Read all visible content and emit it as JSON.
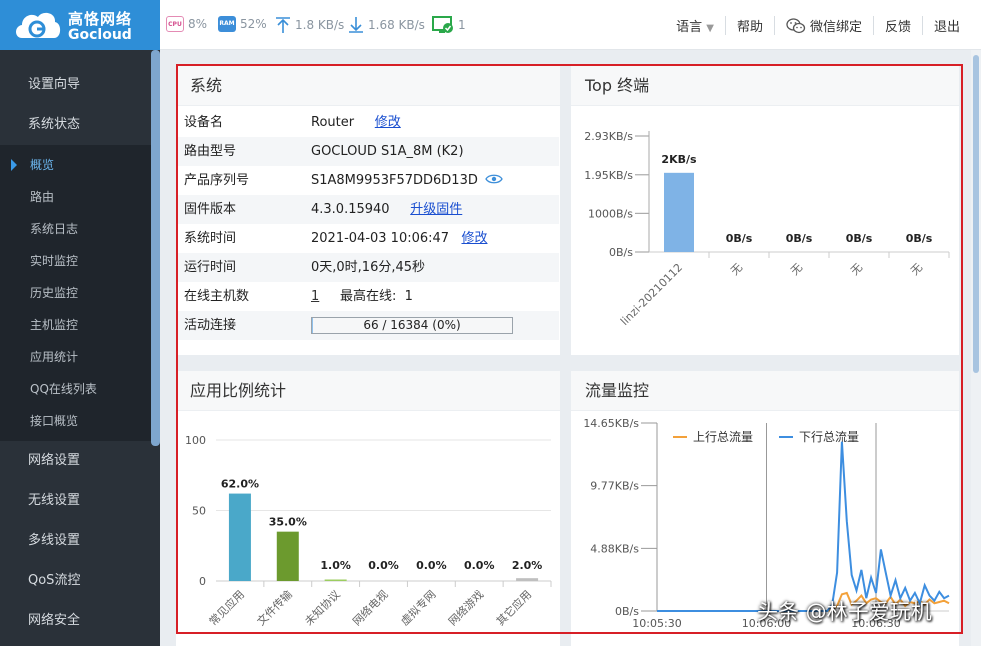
{
  "brand": {
    "name_cn": "高恪网络",
    "name_en": "Gocloud"
  },
  "header_stats": {
    "cpu_icon": "CPU",
    "cpu": "8%",
    "ram_icon": "RAM",
    "ram": "52%",
    "upload": "1.8 KB/s",
    "download": "1.68 KB/s",
    "devices": "1"
  },
  "top_menu": {
    "language": "语言",
    "help": "帮助",
    "wechat": "微信绑定",
    "feedback": "反馈",
    "logout": "退出"
  },
  "sidebar": {
    "groups_top": [
      {
        "label": "设置向导"
      },
      {
        "label": "系统状态"
      }
    ],
    "sub_items": [
      {
        "label": "概览"
      },
      {
        "label": "路由"
      },
      {
        "label": "系统日志"
      },
      {
        "label": "实时监控"
      },
      {
        "label": "历史监控"
      },
      {
        "label": "主机监控"
      },
      {
        "label": "应用统计"
      },
      {
        "label": "QQ在线列表"
      },
      {
        "label": "接口概览"
      }
    ],
    "groups_bottom": [
      {
        "label": "网络设置"
      },
      {
        "label": "无线设置"
      },
      {
        "label": "多线设置"
      },
      {
        "label": "QoS流控"
      },
      {
        "label": "网络安全"
      }
    ]
  },
  "system": {
    "title": "系统",
    "rows": [
      {
        "label": "设备名",
        "value": "Router",
        "link": "修改"
      },
      {
        "label": "路由型号",
        "value": "GOCLOUD S1A_8M (K2)"
      },
      {
        "label": "产品序列号",
        "value": "S1A8M9953F57DD6D13D"
      },
      {
        "label": "固件版本",
        "value": "4.3.0.15940",
        "link": "升级固件"
      },
      {
        "label": "系统时间",
        "value": "2021-04-03 10:06:47",
        "link": "修改"
      },
      {
        "label": "运行时间",
        "value": "0天,0时,16分,45秒"
      },
      {
        "label": "在线主机数",
        "value": "1",
        "extra_label": "最高在线:",
        "extra_value": "1"
      },
      {
        "label": "活动连接",
        "value": "66 / 16384 (0%)"
      }
    ],
    "active_connections_fraction": 0.004
  },
  "top_terminals": {
    "title": "Top 终端",
    "chart_data": {
      "type": "bar",
      "categories": [
        "linzi-20210112",
        "无",
        "无",
        "无",
        "无"
      ],
      "values": [
        2,
        0,
        0,
        0,
        0
      ],
      "value_labels": [
        "2KB/s",
        "0B/s",
        "0B/s",
        "0B/s",
        "0B/s"
      ],
      "yticks": [
        "2.93KB/s",
        "1.95KB/s",
        "1000B/s",
        "0B/s"
      ],
      "ylim": [
        0,
        2.93
      ],
      "unit": "KB/s",
      "color": "#7fb3e6"
    }
  },
  "app_ratio": {
    "title": "应用比例统计",
    "chart_data": {
      "type": "bar",
      "categories": [
        "常见应用",
        "文件传输",
        "未知协议",
        "网络电视",
        "虚拟专网",
        "网络游戏",
        "其它应用"
      ],
      "values": [
        62.0,
        35.0,
        1.0,
        0.0,
        0.0,
        0.0,
        2.0
      ],
      "value_labels": [
        "62.0%",
        "35.0%",
        "1.0%",
        "0.0%",
        "0.0%",
        "0.0%",
        "2.0%"
      ],
      "yticks": [
        "100",
        "50",
        "0"
      ],
      "ylim": [
        0,
        100
      ],
      "colors": [
        "#4aa8c9",
        "#6c9a2e",
        "#9ccd60",
        "#bfbfbf",
        "#bfbfbf",
        "#bfbfbf",
        "#bfbfbf"
      ]
    }
  },
  "traffic": {
    "title": "流量监控",
    "chart_data": {
      "type": "line",
      "yticks": [
        "14.65KB/s",
        "9.77KB/s",
        "4.88KB/s",
        "0B/s"
      ],
      "ylim": [
        0,
        14.65
      ],
      "xticks": [
        "10:05:30",
        "10:06:00",
        "10:06:30"
      ],
      "legend_position": "top-left",
      "series": [
        {
          "name": "上行总流量",
          "color": "#f3a13a",
          "x": [
            0,
            5,
            10,
            15,
            20,
            25,
            28,
            30,
            32,
            34,
            36,
            38,
            40,
            42,
            44,
            46,
            48,
            50,
            52,
            54,
            56,
            58,
            60,
            62,
            64,
            66,
            68,
            70,
            72,
            74,
            76,
            78,
            80,
            82,
            84,
            86,
            88,
            90,
            92,
            94,
            96,
            98,
            100,
            102,
            104,
            106,
            108,
            110,
            112,
            114,
            116,
            118,
            120
          ],
          "y": [
            0,
            0,
            0,
            0,
            0,
            0,
            0,
            0,
            0,
            0,
            0,
            0,
            0,
            0,
            0,
            0,
            0,
            0,
            0,
            0,
            0,
            0,
            0,
            0,
            0,
            0,
            0,
            0,
            0.1,
            0.4,
            1.3,
            1.4,
            0.5,
            0.8,
            1.2,
            0.6,
            0.9,
            1.0,
            0.7,
            0.6,
            1.1,
            0.5,
            0.9,
            0.4,
            0.7,
            0.6,
            0.8,
            0.5,
            0.9,
            0.6,
            0.7,
            0.8,
            0.6
          ]
        },
        {
          "name": "下行总流量",
          "color": "#3d8ee0",
          "x": [
            0,
            5,
            10,
            15,
            20,
            25,
            28,
            30,
            32,
            34,
            36,
            38,
            40,
            42,
            44,
            46,
            48,
            50,
            52,
            54,
            56,
            58,
            60,
            62,
            64,
            66,
            68,
            70,
            72,
            74,
            76,
            78,
            80,
            82,
            84,
            86,
            88,
            90,
            92,
            94,
            96,
            98,
            100,
            102,
            104,
            106,
            108,
            110,
            112,
            114,
            116,
            118,
            120
          ],
          "y": [
            0,
            0,
            0,
            0,
            0,
            0,
            0,
            0,
            0,
            0,
            0,
            0,
            0,
            0,
            0,
            0,
            0,
            0,
            0,
            0,
            0,
            0,
            0,
            0,
            0,
            0,
            0,
            0,
            0.5,
            3.0,
            13.2,
            7.0,
            2.8,
            1.6,
            3.2,
            1.0,
            2.6,
            1.4,
            4.8,
            3.0,
            1.2,
            2.4,
            1.0,
            1.8,
            0.8,
            1.4,
            0.6,
            2.0,
            1.2,
            0.8,
            1.5,
            1.0,
            1.2
          ]
        }
      ],
      "x_domain": [
        0,
        120
      ]
    }
  },
  "watermark": "头条 @林子爱玩机"
}
